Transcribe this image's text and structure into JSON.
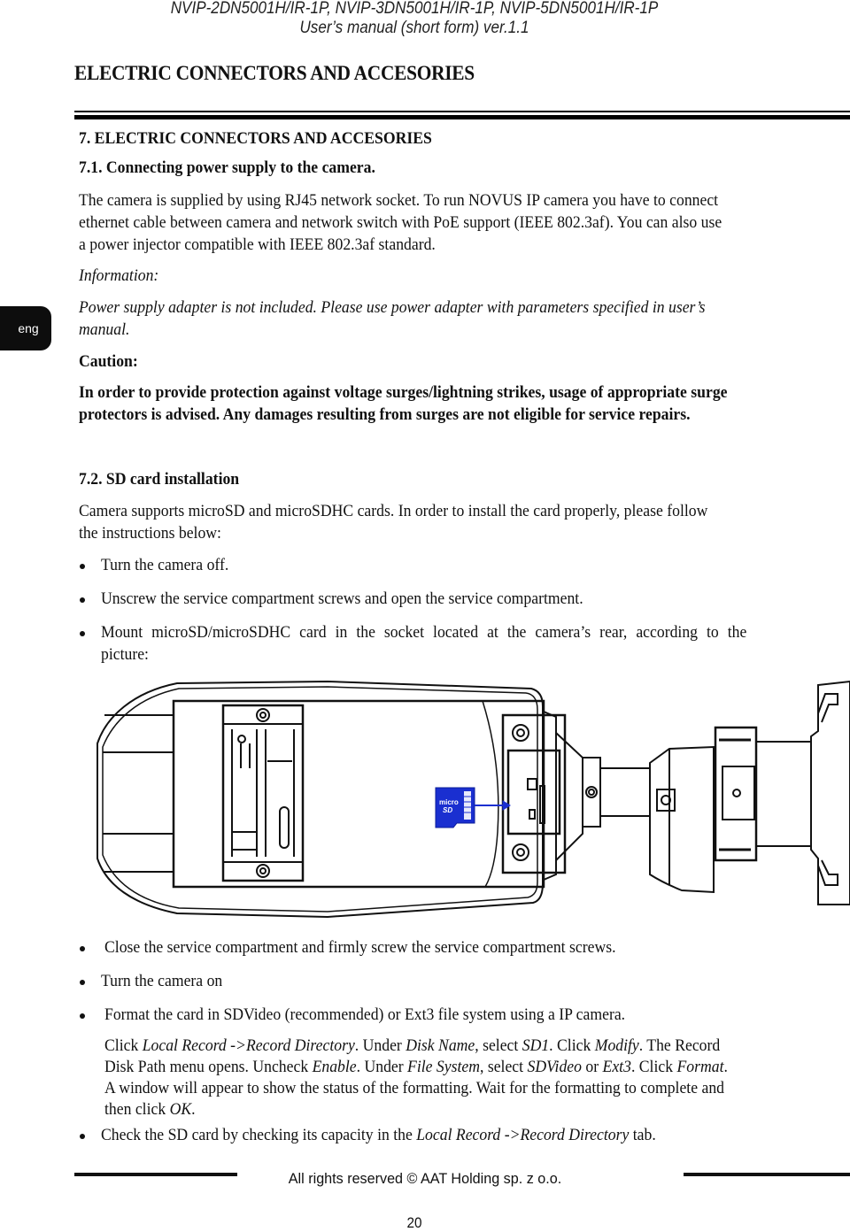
{
  "header": {
    "models": "NVIP-2DN5001H/IR-1P, NVIP-3DN5001H/IR-1P, NVIP-5DN5001H/IR-1P",
    "manual": "User’s manual (short form) ver.1.1"
  },
  "document_title": "ELECTRIC CONNECTORS AND ACCESORIES",
  "language_tab": "eng",
  "section": {
    "heading": "7. ELECTRIC CONNECTORS AND ACCESORIES",
    "subsection_1": {
      "heading": "7.1. Connecting  power supply to the camera.",
      "paragraph_lines": [
        "The camera is supplied by using RJ45 network socket. To run NOVUS IP camera you have to connect",
        "ethernet cable between camera and network switch with PoE support  (IEEE 802.3af). You can also use",
        "a power injector  compatible with IEEE 802.3af standard."
      ],
      "information_label": "Information:",
      "information_lines": [
        "Power supply adapter is not included. Please use power adapter with parameters specified in user’s",
        "manual."
      ],
      "caution_label": "Caution:",
      "caution_lines": [
        "In order to provide protection against voltage surges/lightning strikes, usage of appropriate surge",
        "protectors is advised. Any damages resulting from surges are not eligible for service repairs."
      ]
    },
    "subsection_2": {
      "heading": "7.2. SD card installation",
      "intro_lines": [
        "Camera supports microSD and microSDHC cards. In order to install the card properly, please follow",
        "the instructions below:"
      ],
      "steps_before_figure": [
        "Turn the camera off.",
        "Unscrew the service compartment screws and open the service compartment.",
        "Mount microSD/microSDHC card in the socket located at the camera’s rear, according to the",
        "picture:"
      ],
      "figure": {
        "description": "Camera rear with open service compartment and microSD card insertion",
        "card_label_1": "micro",
        "card_label_2": "SD",
        "card_color": "#1a2fd0"
      },
      "steps_after_figure": [
        "Close the service compartment and firmly screw the service compartment screws.",
        "Turn the camera on",
        "Format the card in SDVideo (recommended) or Ext3 file system using a IP camera."
      ],
      "format_instructions": {
        "line1": {
          "t1": "Click ",
          "i1": "Local Record ->Record Directory",
          "t2": ". Under ",
          "i2": "Disk Name",
          "t3": ", select ",
          "i3": "SD1",
          "t4": ". Click ",
          "i4": "Modify",
          "t5": ". The Record"
        },
        "line2": {
          "t1": "Disk Path menu opens. Uncheck ",
          "i1": "Enable",
          "t2": ". Under ",
          "i2": "File System",
          "t3": ", select ",
          "i3": "SDVideo",
          "t4": " or ",
          "i4": "Ext3",
          "t5": ". Click ",
          "i5": "Format",
          "t6": "."
        },
        "line3": "A window will appear to show the status of the formatting. Wait for the formatting to complete and",
        "line4": {
          "t1": "then click ",
          "i1": "OK",
          "t2": "."
        }
      },
      "last_step": {
        "t1": "Check the SD card by checking its capacity in the ",
        "i1": "Local Record ->Record Directory",
        "t2": " tab."
      }
    }
  },
  "footer": {
    "copyright": "All rights reserved © AAT Holding sp. z o.o.",
    "page_number": "20"
  }
}
